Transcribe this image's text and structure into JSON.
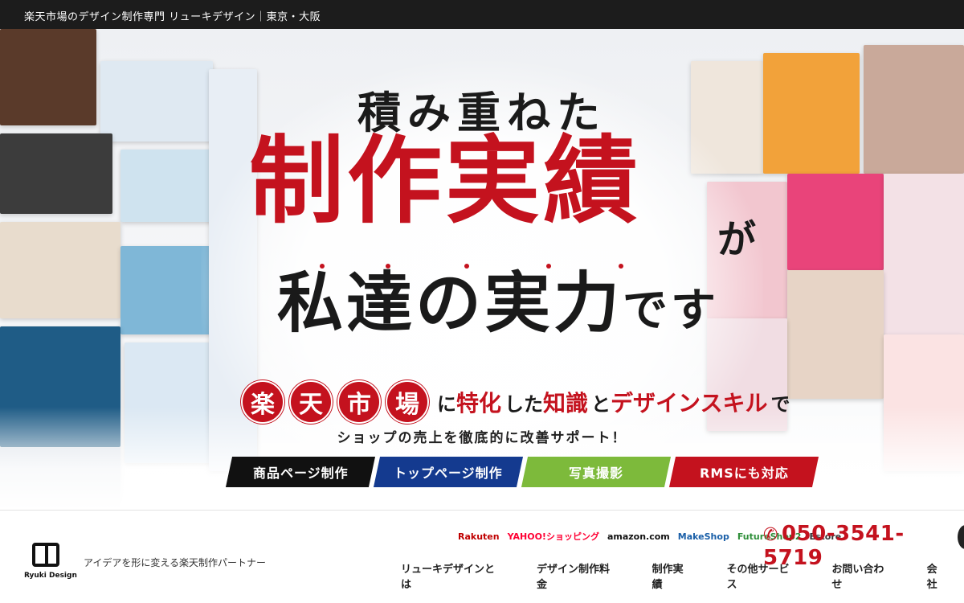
{
  "topbar": {
    "title": "楽天市場のデザイン制作専門 リューキデザイン｜東京・大阪"
  },
  "hero": {
    "line1": "積み重ねた",
    "line2": "制作実績",
    "line2_suffix": "が",
    "line3_a": "私達の実力",
    "line3_b": "です",
    "rakuten_chars": [
      "楽",
      "天",
      "市",
      "場"
    ],
    "row4": [
      {
        "text": "に",
        "style": "t"
      },
      {
        "text": "特化",
        "style": "r"
      },
      {
        "text": "した",
        "style": "t"
      },
      {
        "text": "知識",
        "style": "r"
      },
      {
        "text": "と",
        "style": "t"
      },
      {
        "text": "デザインスキル",
        "style": "r"
      },
      {
        "text": "で",
        "style": "t"
      }
    ],
    "subline": "ショップの売上を徹底的に改善サポート！",
    "buttons": [
      {
        "label": "商品ページ制作",
        "color": "#111111"
      },
      {
        "label": "トップページ制作",
        "color": "#143a8f"
      },
      {
        "label": "写真撮影",
        "color": "#7dba3b"
      },
      {
        "label": "RMSにも対応",
        "color": "#c4121e"
      }
    ]
  },
  "header": {
    "logo_text": "Ryuki Design",
    "tagline": "アイデアを形に変える楽天制作パートナー",
    "platforms": [
      {
        "label": "Rakuten",
        "color": "#bf0000"
      },
      {
        "label": "YAHOO!ショッピング",
        "color": "#ff0033"
      },
      {
        "label": "amazon.com",
        "color": "#111111"
      },
      {
        "label": "MakeShop",
        "color": "#1a5fa8"
      },
      {
        "label": "FutureShop2",
        "color": "#2f8f3a"
      },
      {
        "label": "Estore",
        "color": "#333333"
      }
    ],
    "phone": "050-3541-5719",
    "nav": [
      "リューキデザインとは",
      "デザイン制作料金",
      "制作実績",
      "その他サービス",
      "お問い合わせ",
      "会社"
    ]
  },
  "colors": {
    "accent": "#c4121e",
    "topbar": "#1c1c1c"
  }
}
